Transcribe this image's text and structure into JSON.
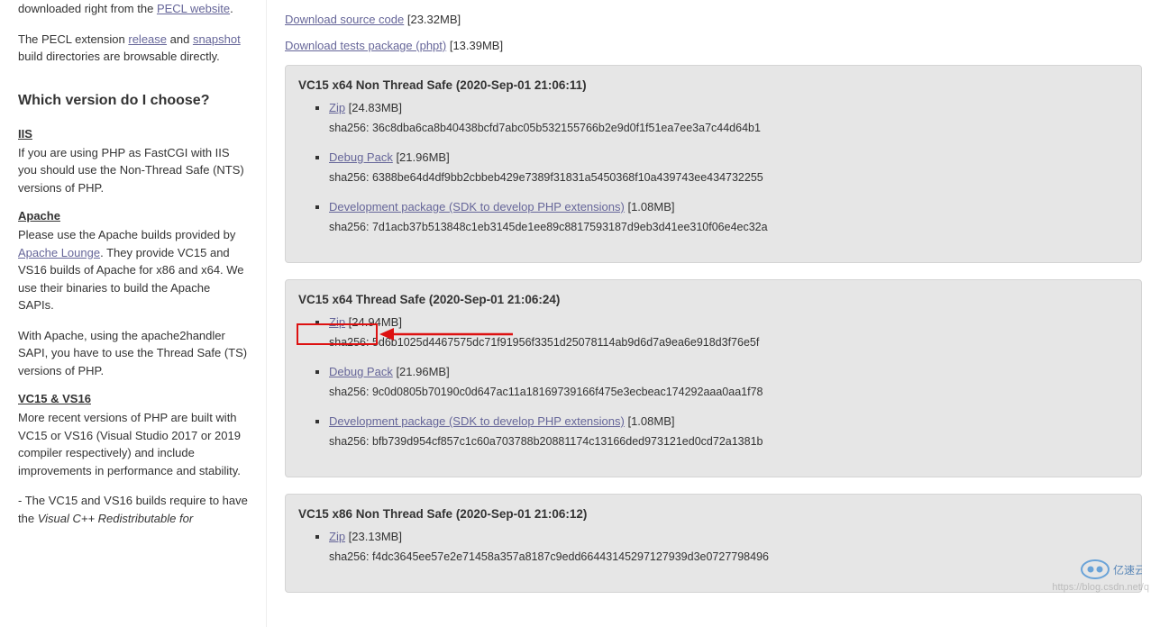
{
  "sidebar": {
    "peclIntroPrefix": "downloaded right from the ",
    "peclLink": "PECL website",
    "peclExtText1": "The PECL extension ",
    "releaseLink": "release",
    "peclExtText2": " and ",
    "snapshotLink": "snapshot",
    "peclExtText3": " build directories are browsable directly.",
    "versionHeading": "Which version do I choose?",
    "iis": {
      "title": "IIS",
      "text": "If you are using PHP as FastCGI with IIS you should use the Non-Thread Safe (NTS) versions of PHP."
    },
    "apache": {
      "title": "Apache",
      "text1a": "Please use the Apache builds provided by ",
      "apacheLoungeLink": "Apache Lounge",
      "text1b": ". They provide VC15 and VS16 builds of Apache for x86 and x64. We use their binaries to build the Apache SAPIs.",
      "text2": "With Apache, using the apache2handler SAPI, you have to use the Thread Safe (TS) versions of PHP."
    },
    "vc": {
      "title": "VC15 & VS16",
      "text1": "More recent versions of PHP are built with VC15 or VS16 (Visual Studio 2017 or 2019 compiler respectively) and include improvements in performance and stability.",
      "text2a": "- The VC15 and VS16 builds require to have the ",
      "text2b": "Visual C++ Redistributable for"
    }
  },
  "topLinks": {
    "sourceLabel": "Download source code",
    "sourceSize": " [23.32MB]",
    "testsLabel": "Download tests package (phpt)",
    "testsSize": " [13.39MB]"
  },
  "releases": [
    {
      "title": "VC15 x64 Non Thread Safe (2020-Sep-01 21:06:11)",
      "items": [
        {
          "label": "Zip",
          "size": " [24.83MB]",
          "sha": "sha256: 36c8dba6ca8b40438bcfd7abc05b532155766b2e9d0f1f51ea7ee3a7c44d64b1"
        },
        {
          "label": "Debug Pack",
          "size": " [21.96MB]",
          "sha": "sha256: 6388be64d4df9bb2cbbeb429e7389f31831a5450368f10a439743ee434732255"
        },
        {
          "label": "Development package (SDK to develop PHP extensions)",
          "size": " [1.08MB]",
          "sha": "sha256: 7d1acb37b513848c1eb3145de1ee89c8817593187d9eb3d41ee310f06e4ec32a"
        }
      ]
    },
    {
      "title": "VC15 x64 Thread Safe (2020-Sep-01 21:06:24)",
      "items": [
        {
          "label": "Zip",
          "size": " [24.94MB]",
          "sha": "sha256: 5d6b1025d4467575dc71f91956f3351d25078114ab9d6d7a9ea6e918d3f76e5f"
        },
        {
          "label": "Debug Pack",
          "size": " [21.96MB]",
          "sha": "sha256: 9c0d0805b70190c0d647ac11a18169739166f475e3ecbeac174292aaa0aa1f78"
        },
        {
          "label": "Development package (SDK to develop PHP extensions)",
          "size": " [1.08MB]",
          "sha": "sha256: bfb739d954cf857c1c60a703788b20881174c13166ded973121ed0cd72a1381b"
        }
      ]
    },
    {
      "title": "VC15 x86 Non Thread Safe (2020-Sep-01 21:06:12)",
      "items": [
        {
          "label": "Zip",
          "size": " [23.13MB]",
          "sha": "sha256: f4dc3645ee57e2e71458a357a8187c9edd66443145297127939d3e0727798496"
        }
      ]
    }
  ],
  "watermark": "https://blog.csdn.net/q",
  "logoText": "亿速云"
}
